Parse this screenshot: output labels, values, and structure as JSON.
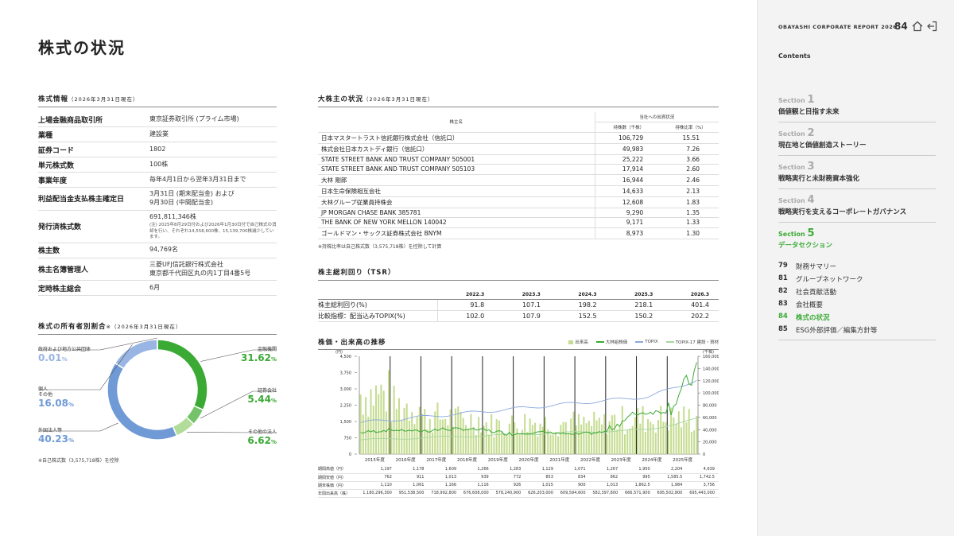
{
  "page_title": "株式の状況",
  "stock_info": {
    "heading": "株式情報",
    "date": "（2026年3月31日現在）",
    "rows": [
      {
        "k": "上場金融商品取引所",
        "v": "東京証券取引所 (プライム市場)"
      },
      {
        "k": "業種",
        "v": "建設業"
      },
      {
        "k": "証券コード",
        "v": "1802"
      },
      {
        "k": "単元株式数",
        "v": "100株"
      },
      {
        "k": "事業年度",
        "v": "毎年4月1日から翌年3月31日まで"
      },
      {
        "k": "利益配当金支払株主確定日",
        "v": "3月31日 (期末配当金) および",
        "v2": "9月30日 (中間配当金)"
      },
      {
        "k": "発行済株式数",
        "v": "691,811,346株",
        "note": "(注) 2025年8月29日付および2026年1月30日付で自己株式の消却を行い、それぞれ14,558,600株、15,139,700株減少しています。"
      },
      {
        "k": "株主数",
        "v": "94,769名"
      },
      {
        "k": "株主名簿管理人",
        "v": "三菱UFJ信託銀行株式会社",
        "v2": "東京都千代田区丸の内1丁目4番5号"
      },
      {
        "k": "定時株主総会",
        "v": "6月"
      }
    ]
  },
  "ownership": {
    "heading": "株式の所有者別割合",
    "mark": "※",
    "date": "（2026年3月31日現在）",
    "segments": [
      {
        "name": "金融機関",
        "value": 31.62,
        "display": "31.62",
        "color": "#3aaa35"
      },
      {
        "name": "証券会社",
        "value": 5.44,
        "display": "5.44",
        "color": "#74c36a"
      },
      {
        "name": "その他の法人",
        "value": 6.62,
        "display": "6.62",
        "color": "#b2dc9a"
      },
      {
        "name": "外国法人等",
        "value": 40.23,
        "display": "40.23",
        "color": "#6f9ad6"
      },
      {
        "name": "個人その他",
        "name1": "個人",
        "name2": "その他",
        "value": 16.08,
        "display": "16.08",
        "color": "#98b5e3"
      },
      {
        "name": "政府および地方公共団体",
        "value": 0.01,
        "display": "0.01",
        "color": "#c8d8f0"
      }
    ],
    "pct": "%",
    "note": "※自己株式数（3,575,718株）を控除"
  },
  "major": {
    "heading": "大株主の状況",
    "date": "（2026年3月31日現在）",
    "col_name": "株主名",
    "col_group": "当社への出資状況",
    "col_shares": "持株数（千株）",
    "col_ratio": "持株比率（%）",
    "rows": [
      {
        "name": "日本マスタートラスト信託銀行株式会社（信託口）",
        "shares": "106,729",
        "ratio": "15.51"
      },
      {
        "name": "株式会社日本カストディ銀行（信託口）",
        "shares": "49,983",
        "ratio": "7.26"
      },
      {
        "name": "STATE STREET BANK AND TRUST COMPANY 505001",
        "shares": "25,222",
        "ratio": "3.66"
      },
      {
        "name": "STATE STREET BANK AND TRUST COMPANY 505103",
        "shares": "17,914",
        "ratio": "2.60"
      },
      {
        "name": "大林 剛郎",
        "shares": "16,944",
        "ratio": "2.46"
      },
      {
        "name": "日本生命保険相互会社",
        "shares": "14,633",
        "ratio": "2.13"
      },
      {
        "name": "大林グループ従業員持株会",
        "shares": "12,608",
        "ratio": "1.83"
      },
      {
        "name": "JP MORGAN CHASE BANK 385781",
        "shares": "9,290",
        "ratio": "1.35"
      },
      {
        "name": "THE BANK OF NEW YORK MELLON 140042",
        "shares": "9,171",
        "ratio": "1.33"
      },
      {
        "name": "ゴールドマン・サックス証券株式会社 BNYM",
        "shares": "8,973",
        "ratio": "1.30"
      }
    ],
    "note": "※持株比率は自己株式数（3,575,718株）を控除して計算"
  },
  "tsr": {
    "heading": "株主総利回り（TSR）",
    "years": [
      "2022.3",
      "2023.3",
      "2024.3",
      "2025.3",
      "2026.3"
    ],
    "rows": [
      {
        "label": "株主総利回り(%)",
        "values": [
          "91.8",
          "107.1",
          "198.2",
          "218.1",
          "401.4"
        ]
      },
      {
        "label": "比較指標：配当込みTOPIX(%)",
        "values": [
          "102.0",
          "107.9",
          "152.5",
          "150.2",
          "202.2"
        ]
      }
    ]
  },
  "stock_chart": {
    "heading": "株価・出来高の推移",
    "legend": [
      "出来高",
      "大林組株価",
      "TOPIX",
      "TOPIX-17 建設・資材"
    ],
    "left_unit": "(円)",
    "right_unit": "(千株)",
    "left_ticks": [
      "4,500",
      "3,750",
      "3,000",
      "2,250",
      "1,500",
      "750",
      "0"
    ],
    "right_ticks": [
      "160,000",
      "140,000",
      "120,000",
      "100,000",
      "80,000",
      "60,000",
      "40,000",
      "20,000",
      "0"
    ],
    "years": [
      "2015年度",
      "2016年度",
      "2017年度",
      "2018年度",
      "2019年度",
      "2020年度",
      "2021年度",
      "2022年度",
      "2023年度",
      "2024年度",
      "2025年度"
    ],
    "table": [
      {
        "label": "期間高値（円）",
        "values": [
          "1,197",
          "1,178",
          "1,609",
          "1,266",
          "1,283",
          "1,129",
          "1,071",
          "1,267",
          "1,950",
          "2,204",
          "4,639"
        ]
      },
      {
        "label": "期間安値（円）",
        "values": [
          "762",
          "911",
          "1,013",
          "939",
          "772",
          "853",
          "834",
          "862",
          "995",
          "1,585.5",
          "1,742.5"
        ]
      },
      {
        "label": "期末株価（円）",
        "values": [
          "1,110",
          "1,061",
          "1,166",
          "1,116",
          "926",
          "1,015",
          "900",
          "1,013",
          "1,862.5",
          "1,984",
          "3,756"
        ]
      },
      {
        "label": "年間出来高（株）",
        "values": [
          "1,180,296,300",
          "951,538,500",
          "718,992,800",
          "676,608,000",
          "578,240,900",
          "626,203,000",
          "609,594,600",
          "582,397,800",
          "666,571,900",
          "695,502,800",
          "695,443,000"
        ]
      }
    ],
    "colors": {
      "volume": "#c5dc90",
      "price": "#3aaa35",
      "topix": "#8aa8dc",
      "construction": "#a8d6a0"
    }
  },
  "panel": {
    "report": "OBAYASHI CORPORATE REPORT 2026",
    "page": "84",
    "contents": "Contents",
    "section_word": "Section",
    "sections": [
      {
        "no": "1",
        "name": "価値観と目指す未来"
      },
      {
        "no": "2",
        "name": "現在地と価値創造ストーリー"
      },
      {
        "no": "3",
        "name": "戦略実行と未財務資本強化"
      },
      {
        "no": "4",
        "name": "戦略実行を支えるコーポレートガバナンス"
      },
      {
        "no": "5",
        "name": "データセクション"
      }
    ],
    "subs": [
      {
        "p": "79",
        "name": "財務サマリー"
      },
      {
        "p": "81",
        "name": "グループネットワーク"
      },
      {
        "p": "82",
        "name": "社会貢献活動"
      },
      {
        "p": "83",
        "name": "会社概要"
      },
      {
        "p": "84",
        "name": "株式の状況"
      },
      {
        "p": "85",
        "name": "ESG外部評価／編集方針等"
      }
    ]
  }
}
